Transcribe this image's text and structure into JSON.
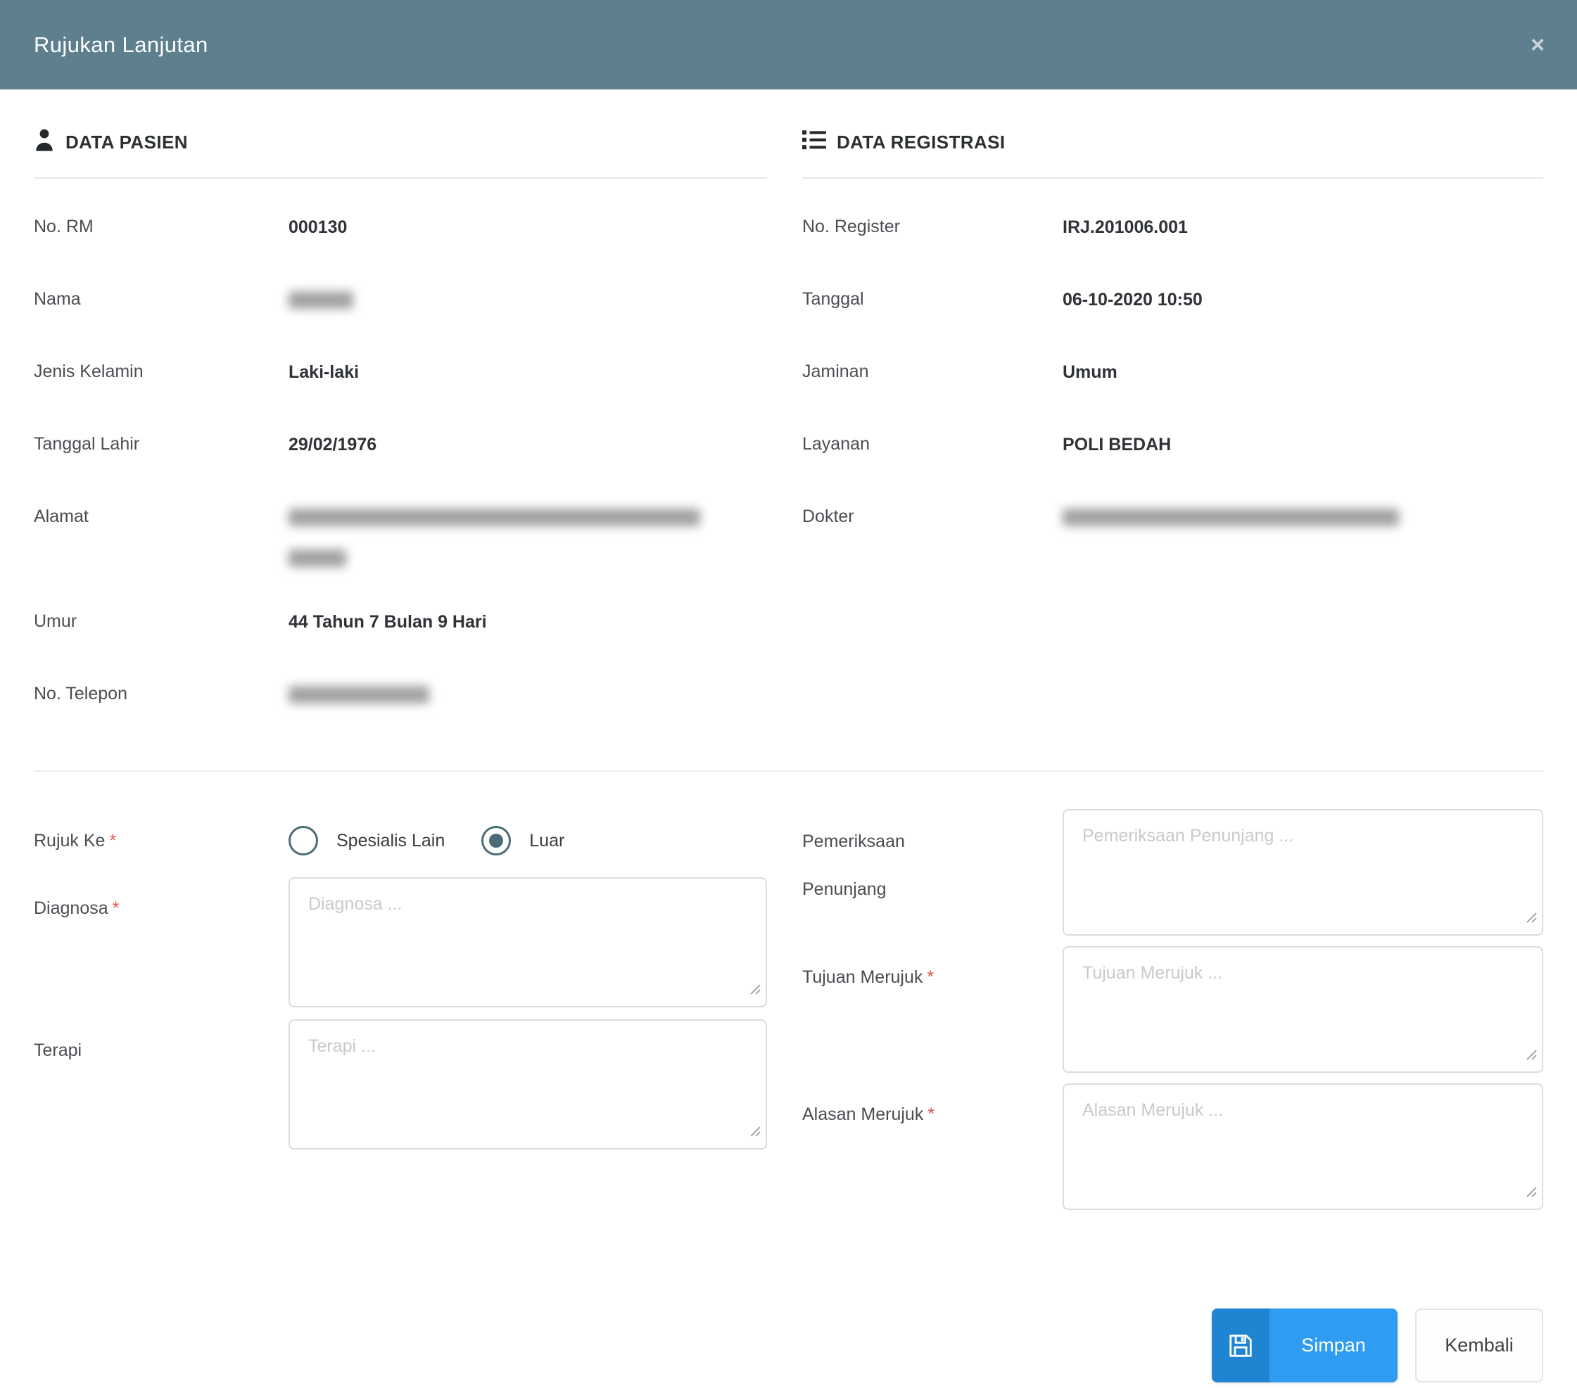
{
  "modal": {
    "title": "Rujukan Lanjutan",
    "close_glyph": "×"
  },
  "sections": {
    "patient": {
      "heading": "DATA PASIEN",
      "icon": "user-icon",
      "fields": [
        {
          "label": "No. RM",
          "value": "000130",
          "redacted": false
        },
        {
          "label": "Nama",
          "value": "",
          "redacted": true
        },
        {
          "label": "Jenis Kelamin",
          "value": "Laki-laki",
          "redacted": false
        },
        {
          "label": "Tanggal Lahir",
          "value": "29/02/1976",
          "redacted": false
        },
        {
          "label": "Alamat",
          "value": "",
          "redacted": true,
          "lines": 2
        },
        {
          "label": "Umur",
          "value": "44 Tahun 7 Bulan 9 Hari",
          "redacted": false
        },
        {
          "label": "No. Telepon",
          "value": "",
          "redacted": true
        }
      ]
    },
    "registration": {
      "heading": "DATA REGISTRASI",
      "icon": "list-icon",
      "fields": [
        {
          "label": "No. Register",
          "value": "IRJ.201006.001",
          "redacted": false
        },
        {
          "label": "Tanggal",
          "value": "06-10-2020 10:50",
          "redacted": false
        },
        {
          "label": "Jaminan",
          "value": "Umum",
          "redacted": false
        },
        {
          "label": "Layanan",
          "value": "POLI BEDAH",
          "redacted": false
        },
        {
          "label": "Dokter",
          "value": "",
          "redacted": true
        }
      ]
    }
  },
  "form": {
    "asterisk": "*",
    "rujuk_ke": {
      "label": "Rujuk Ke",
      "required": true,
      "options": [
        {
          "label": "Spesialis Lain",
          "selected": false
        },
        {
          "label": "Luar",
          "selected": true
        }
      ]
    },
    "diagnosa": {
      "label": "Diagnosa",
      "required": true,
      "value": "",
      "placeholder": "Diagnosa ..."
    },
    "terapi": {
      "label": "Terapi",
      "required": false,
      "value": "",
      "placeholder": "Terapi ..."
    },
    "pemeriksaan_penunjang": {
      "label": "Pemeriksaan Penunjang",
      "required": false,
      "value": "",
      "placeholder": "Pemeriksaan Penunjang ..."
    },
    "tujuan_merujuk": {
      "label": "Tujuan Merujuk",
      "required": true,
      "value": "",
      "placeholder": "Tujuan Merujuk ..."
    },
    "alasan_merujuk": {
      "label": "Alasan Merujuk",
      "required": true,
      "value": "",
      "placeholder": "Alasan Merujuk ..."
    }
  },
  "footer": {
    "save_label": "Simpan",
    "back_label": "Kembali"
  },
  "colors": {
    "header_bg": "#5E7F8D",
    "primary_button": "#2F9CF1",
    "primary_button_icon_bg": "#1F85D3",
    "required_mark": "#E8554A",
    "radio_accent": "#4C6B77"
  }
}
